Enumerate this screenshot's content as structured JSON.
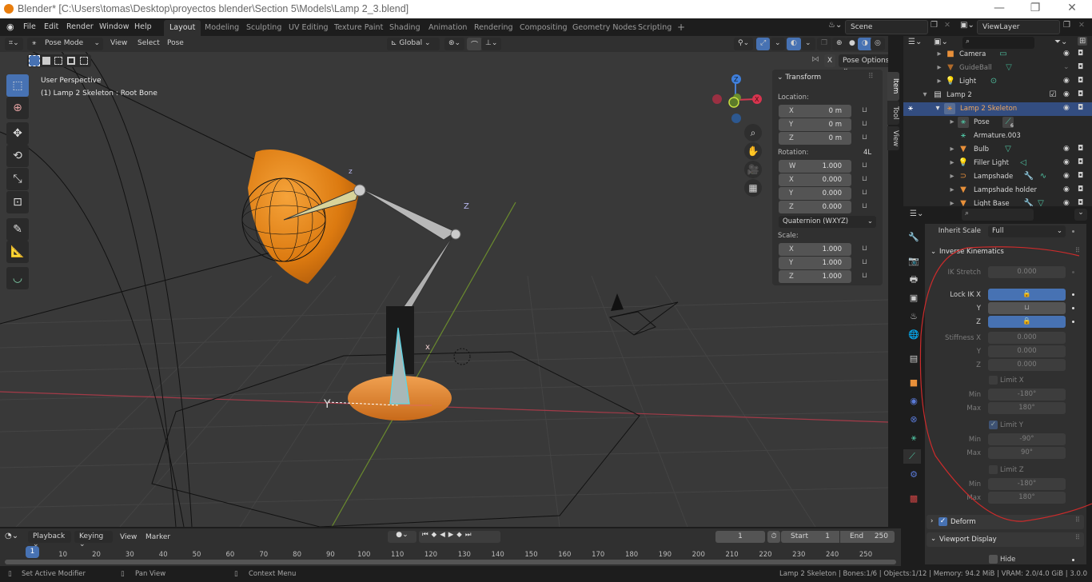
{
  "window": {
    "title": "Blender* [C:\\Users\\tomas\\Desktop\\proyectos blender\\Section 5\\Models\\Lamp 2_3.blend]",
    "controls": {
      "minimize": "—",
      "maximize": "❐",
      "close": "✕"
    }
  },
  "menu": [
    "File",
    "Edit",
    "Render",
    "Window",
    "Help"
  ],
  "workspaces": {
    "active": "Layout",
    "tabs": [
      "Layout",
      "Modeling",
      "Sculpting",
      "UV Editing",
      "Texture Paint",
      "Shading",
      "Animation",
      "Rendering",
      "Compositing",
      "Geometry Nodes",
      "Scripting"
    ],
    "add": "+"
  },
  "scene": {
    "scene_name": "Scene",
    "view_layer": "ViewLayer"
  },
  "viewport_header": {
    "mode": "Pose Mode",
    "menus": [
      "View",
      "Select",
      "Pose"
    ],
    "orientation": "Global",
    "pose_options": "Pose Options",
    "x_mirror": "X"
  },
  "viewport": {
    "view_name": "User Perspective",
    "object_info": "(1) Lamp 2 Skeleton : Root Bone",
    "axis_labels": {
      "x": "X",
      "y": "Y",
      "z": "Z"
    },
    "floor_axis_label": "Y",
    "accent_color": "#4772b3",
    "object_color": "#e87d0d"
  },
  "transform_panel": {
    "title": "Transform",
    "location_label": "Location:",
    "location": [
      {
        "axis": "X",
        "value": "0 m"
      },
      {
        "axis": "Y",
        "value": "0 m"
      },
      {
        "axis": "Z",
        "value": "0 m"
      }
    ],
    "rotation_label": "Rotation:",
    "rotation_mode_flag": "4L",
    "rotation": [
      {
        "axis": "W",
        "value": "1.000"
      },
      {
        "axis": "X",
        "value": "0.000"
      },
      {
        "axis": "Y",
        "value": "0.000"
      },
      {
        "axis": "Z",
        "value": "0.000"
      }
    ],
    "rotation_mode": "Quaternion (WXYZ)",
    "scale_label": "Scale:",
    "scale": [
      {
        "axis": "X",
        "value": "1.000"
      },
      {
        "axis": "Y",
        "value": "1.000"
      },
      {
        "axis": "Z",
        "value": "1.000"
      }
    ]
  },
  "sidebar_tabs": [
    "Item",
    "Tool",
    "View"
  ],
  "outliner": {
    "search_placeholder": "",
    "rows": [
      {
        "label": "Camera",
        "indent": 1,
        "icon": "camera-icon",
        "visible": true
      },
      {
        "label": "GuideBall",
        "indent": 1,
        "icon": "mesh-icon",
        "visible": false
      },
      {
        "label": "Light",
        "indent": 1,
        "icon": "light-icon",
        "visible": true
      },
      {
        "label": "Lamp 2",
        "indent": 0,
        "icon": "collection-icon",
        "visible": true
      },
      {
        "label": "Lamp 2 Skeleton",
        "indent": 1,
        "icon": "armature-icon",
        "visible": true,
        "selected": true
      },
      {
        "label": "Pose",
        "indent": 2,
        "icon": "pose-icon",
        "badge": "6"
      },
      {
        "label": "Armature.003",
        "indent": 2,
        "icon": "armature-data-icon"
      },
      {
        "label": "Bulb",
        "indent": 2,
        "icon": "mesh-icon",
        "visible": true
      },
      {
        "label": "Filler Light",
        "indent": 2,
        "icon": "light-icon",
        "visible": true
      },
      {
        "label": "Lampshade",
        "indent": 2,
        "icon": "curve-icon",
        "visible": true
      },
      {
        "label": "Lampshade holder",
        "indent": 2,
        "icon": "mesh-icon",
        "visible": true
      },
      {
        "label": "Light Base",
        "indent": 2,
        "icon": "mesh-icon",
        "visible": true
      }
    ]
  },
  "properties": {
    "inherit_scale_label": "Inherit Scale",
    "inherit_scale_value": "Full",
    "ik_section": "Inverse Kinematics",
    "ik_stretch_label": "IK Stretch",
    "ik_stretch": "0.000",
    "lock_ik_label": "Lock IK X",
    "lock_ik": [
      {
        "axis": "Lock IK X",
        "locked": true
      },
      {
        "axis": "Y",
        "locked": false
      },
      {
        "axis": "Z",
        "locked": true
      }
    ],
    "stiffness": [
      {
        "label": "Stiffness X",
        "value": "0.000"
      },
      {
        "label": "Y",
        "value": "0.000"
      },
      {
        "label": "Z",
        "value": "0.000"
      }
    ],
    "limits": [
      {
        "label": "Limit X",
        "checked": false,
        "min": "-180°",
        "max": "180°"
      },
      {
        "label": "Limit Y",
        "checked": true,
        "min": "-90°",
        "max": "90°"
      },
      {
        "label": "Limit Z",
        "checked": false,
        "min": "-180°",
        "max": "180°"
      }
    ],
    "min_label": "Min",
    "max_label": "Max",
    "deform_section": "Deform",
    "deform_checked": true,
    "viewport_display_section": "Viewport Display",
    "hide_label": "Hide"
  },
  "timeline": {
    "menus": [
      "Playback",
      "Keying",
      "View",
      "Marker"
    ],
    "current_frame": "1",
    "start_label": "Start",
    "start": "1",
    "end_label": "End",
    "end": "250",
    "ticks": [
      "10",
      "20",
      "30",
      "40",
      "50",
      "60",
      "70",
      "80",
      "90",
      "100",
      "110",
      "120",
      "130",
      "140",
      "150",
      "160",
      "170",
      "180",
      "190",
      "200",
      "210",
      "220",
      "230",
      "240",
      "250"
    ],
    "playhead": "1"
  },
  "statusbar": {
    "hints": [
      "Set Active Modifier",
      "Pan View",
      "Context Menu"
    ],
    "info": "Lamp 2 Skeleton | Bones:1/6 | Objects:1/12 | Memory: 94.2 MiB | VRAM: 2.0/4.0 GiB | 3.0.0"
  }
}
